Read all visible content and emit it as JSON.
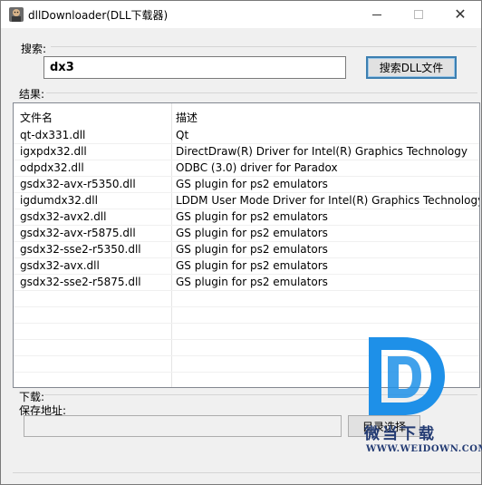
{
  "window": {
    "title": "dllDownloader(DLL下载器)",
    "icon": "app-icon",
    "controls": {
      "minimize": "minimize-icon",
      "maximize": "maximize-icon",
      "close": "✕"
    }
  },
  "search": {
    "label": "搜索:",
    "value": "dx3",
    "button_label": "搜索DLL文件"
  },
  "results": {
    "label": "结果:",
    "columns": [
      "文件名",
      "描述"
    ],
    "rows": [
      [
        "qt-dx331.dll",
        "Qt"
      ],
      [
        "igxpdx32.dll",
        "DirectDraw(R) Driver for Intel(R) Graphics Technology"
      ],
      [
        "odpdx32.dll",
        "ODBC (3.0) driver for Paradox"
      ],
      [
        "gsdx32-avx-r5350.dll",
        "GS plugin for ps2 emulators"
      ],
      [
        "igdumdx32.dll",
        "LDDM User Mode Driver for Intel(R) Graphics Technology"
      ],
      [
        "gsdx32-avx2.dll",
        "GS plugin for ps2 emulators"
      ],
      [
        "gsdx32-avx-r5875.dll",
        "GS plugin for ps2 emulators"
      ],
      [
        "gsdx32-sse2-r5350.dll",
        "GS plugin for ps2 emulators"
      ],
      [
        "gsdx32-avx.dll",
        "GS plugin for ps2 emulators"
      ],
      [
        "gsdx32-sse2-r5875.dll",
        "GS plugin for ps2 emulators"
      ]
    ]
  },
  "download": {
    "label": "下载:",
    "save_path_label": "保存地址:",
    "save_path_value": "",
    "dir_button_label": "目录选择"
  },
  "watermark": {
    "brand_cn": "微当下载",
    "url": "WWW.WEIDOWN.COM",
    "colors": {
      "primary": "#233b73",
      "accent": "#1e90e8"
    }
  }
}
